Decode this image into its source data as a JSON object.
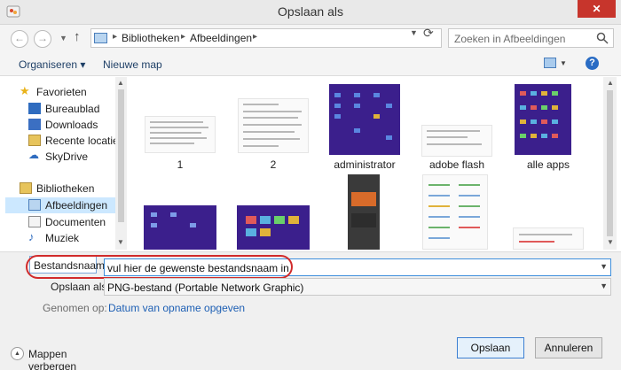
{
  "window": {
    "title": "Opslaan als",
    "close_glyph": "✕"
  },
  "nav": {
    "back_glyph": "←",
    "forward_glyph": "→",
    "up_glyph": "↑",
    "breadcrumbs": [
      "Bibliotheken",
      "Afbeeldingen"
    ],
    "search_placeholder": "Zoeken in Afbeeldingen"
  },
  "commands": {
    "organize": "Organiseren ▾",
    "new_folder": "Nieuwe map",
    "help": "?"
  },
  "sidebar": {
    "favorites_label": "Favorieten",
    "favorites": [
      "Bureaublad",
      "Downloads",
      "Recente locaties",
      "SkyDrive"
    ],
    "libraries_label": "Bibliotheken",
    "libraries": [
      "Afbeeldingen",
      "Documenten",
      "Muziek"
    ]
  },
  "files": [
    {
      "name": "1"
    },
    {
      "name": "2"
    },
    {
      "name": "administrator"
    },
    {
      "name": "adobe flash"
    },
    {
      "name": "alle apps"
    }
  ],
  "form": {
    "filename_label": "Bestandsnaam:",
    "filename_value": "vul hier de gewenste bestandsnaam in",
    "savetype_label": "Opslaan als:",
    "savetype_value": "PNG-bestand (Portable Network Graphic)",
    "taken_label": "Genomen op:",
    "taken_link": "Datum van opname opgeven",
    "hide_folders": "Mappen verbergen",
    "save_button": "Opslaan",
    "cancel_button": "Annuleren"
  },
  "colors": {
    "accent": "#3f8fdc",
    "highlight": "#d12b2b",
    "selection": "#cce8ff",
    "tile_purple": "#3b1f8c"
  }
}
